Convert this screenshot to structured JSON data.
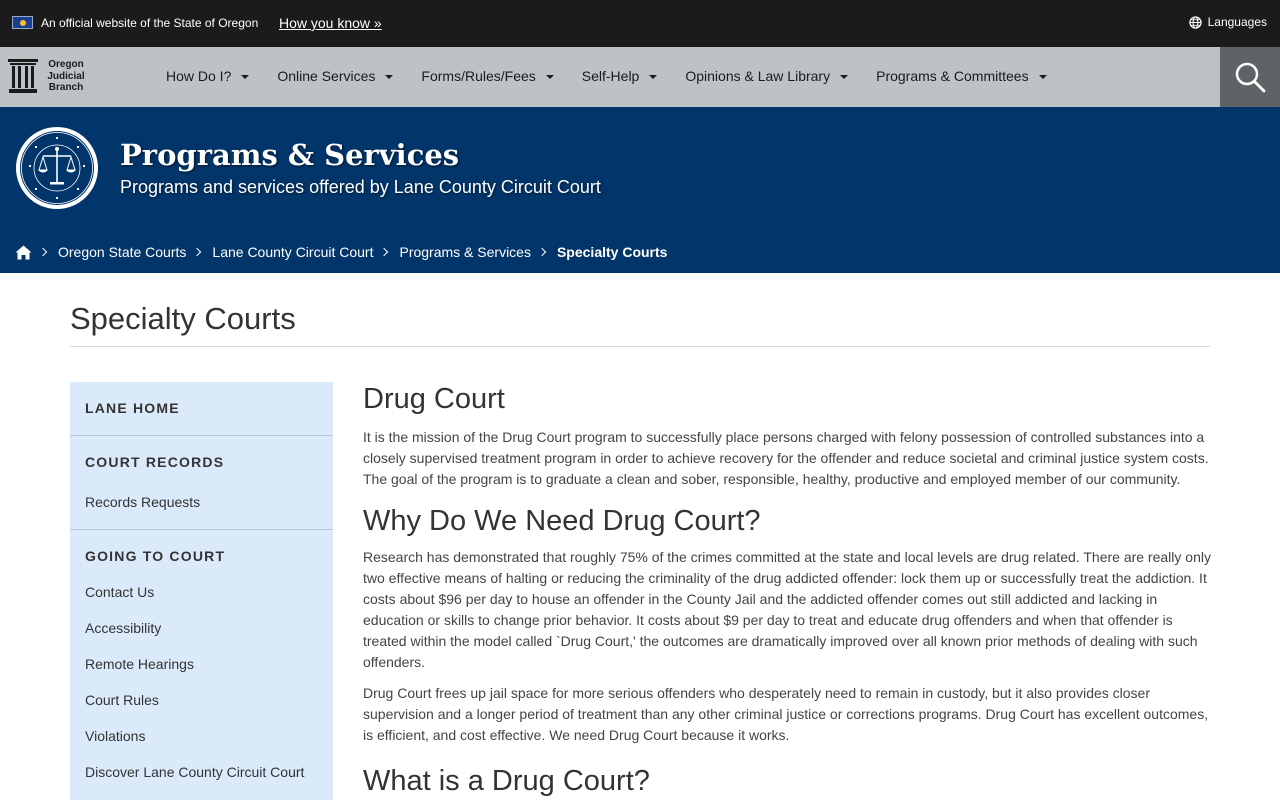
{
  "official_bar": {
    "text": "An official website of the State of Oregon",
    "link": "How you know »",
    "languages": "Languages"
  },
  "nav": {
    "logo_lines": [
      "Oregon",
      "Judicial",
      "Branch"
    ],
    "items": [
      {
        "label": "How Do I?"
      },
      {
        "label": "Online Services"
      },
      {
        "label": "Forms/Rules/Fees"
      },
      {
        "label": "Self-Help"
      },
      {
        "label": "Opinions & Law Library"
      },
      {
        "label": "Programs & Committees"
      }
    ]
  },
  "hero": {
    "title": "Programs & Services",
    "subtitle": "Programs and services offered by Lane County Circuit Court"
  },
  "breadcrumb": {
    "items": [
      "Oregon State Courts",
      "Lane County Circuit Court",
      "Programs & Services"
    ],
    "current": "Specialty Courts"
  },
  "page": {
    "title": "Specialty Courts"
  },
  "sidebar": {
    "sections": [
      {
        "heading": "LANE HOME",
        "links": []
      },
      {
        "heading": "COURT RECORDS",
        "links": [
          "Records Requests"
        ]
      },
      {
        "heading": "GOING TO COURT",
        "links": [
          "Contact Us",
          "Accessibility",
          "Remote Hearings",
          "Court Rules",
          "Violations",
          "Discover Lane County Circuit Court"
        ]
      }
    ]
  },
  "content": {
    "h1": "Drug Court",
    "p1": "It is the mission of the Drug Court program to successfully place persons charged with felony possession of controlled substances into a closely supervised treatment program in order to achieve recovery for the offender and reduce societal and criminal justice system costs. The goal of the program is to graduate a clean and sober, responsible, healthy, productive and employed member of our community.",
    "h2": "Why Do We Need Drug Court?",
    "p2": "Research has demonstrated that roughly 75% of the crimes committed at the state and local levels are drug related. There are really only two effective means of halting or reducing the criminality of the drug addicted offender: lock them up or successfully treat the addiction. It costs about $96 per day to house an offender in the County Jail and the addicted offender comes out still addicted and lacking in education or skills to change prior behavior. It costs about $9 per day to treat and educate drug offenders and when that offender is treated within the model called `Drug Court,' the outcomes are dramatically improved over all known prior methods of dealing with such offenders.",
    "p3": "Drug Court frees up jail space for more serious offenders who desperately need to remain in custody, but it also provides closer supervision and a longer period of treatment than any other criminal justice or corrections programs. Drug Court has excellent outcomes, is efficient, and cost effective. We need Drug Court because it works.",
    "h3": "What is a Drug Court?"
  },
  "colors": {
    "top_bar": "#1b1b1b",
    "nav_bar": "#bdc2c5",
    "search_button": "#5f6366",
    "hero": "#023569",
    "sidebar": "#dbeafb"
  }
}
